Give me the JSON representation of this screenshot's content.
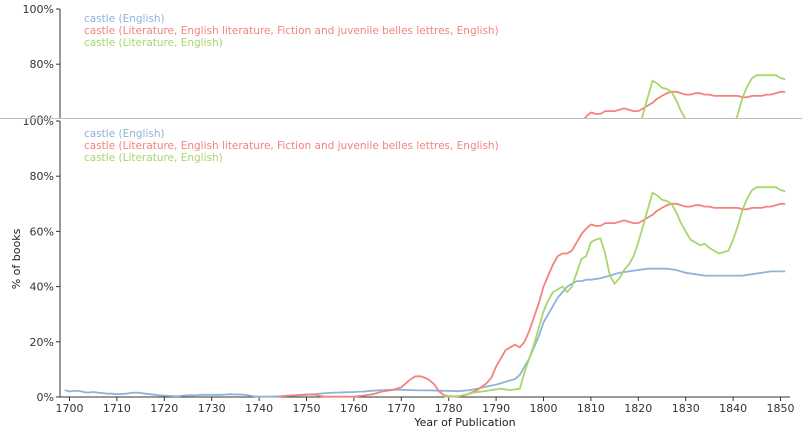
{
  "chart_data": {
    "type": "line",
    "xlabel": "Year of Publication",
    "ylabel": "% of books",
    "xlim": [
      1698,
      1852
    ],
    "ylim": [
      0,
      100
    ],
    "x_ticks": [
      "1700",
      "1710",
      "1720",
      "1730",
      "1740",
      "1750",
      "1760",
      "1770",
      "1780",
      "1790",
      "1800",
      "1810",
      "1820",
      "1830",
      "1840",
      "1850"
    ],
    "y_ticks": [
      "0%",
      "20%",
      "40%",
      "60%",
      "80%",
      "100%"
    ],
    "legend_position": "top-left",
    "grid": false,
    "series": [
      {
        "name": "castle (English)",
        "color": "#8fb3d9",
        "points": [
          [
            1699,
            2.5
          ],
          [
            1700,
            2
          ],
          [
            1701,
            2.2
          ],
          [
            1702,
            2.2
          ],
          [
            1703,
            1.8
          ],
          [
            1704,
            1.6
          ],
          [
            1705,
            1.8
          ],
          [
            1706,
            1.6
          ],
          [
            1707,
            1.4
          ],
          [
            1708,
            1.2
          ],
          [
            1709,
            1.2
          ],
          [
            1710,
            1
          ],
          [
            1711,
            1.1
          ],
          [
            1712,
            1.2
          ],
          [
            1713,
            1.5
          ],
          [
            1714,
            1.6
          ],
          [
            1715,
            1.5
          ],
          [
            1716,
            1.2
          ],
          [
            1717,
            1
          ],
          [
            1718,
            0.8
          ],
          [
            1719,
            0.6
          ],
          [
            1720,
            0.5
          ],
          [
            1721,
            0.4
          ],
          [
            1722,
            0.3
          ],
          [
            1723,
            0.3
          ],
          [
            1724,
            0.5
          ],
          [
            1725,
            0.6
          ],
          [
            1726,
            0.6
          ],
          [
            1727,
            0.7
          ],
          [
            1728,
            0.8
          ],
          [
            1729,
            0.8
          ],
          [
            1730,
            0.8
          ],
          [
            1731,
            0.8
          ],
          [
            1732,
            0.8
          ],
          [
            1733,
            0.9
          ],
          [
            1734,
            1
          ],
          [
            1735,
            0.9
          ],
          [
            1736,
            0.9
          ],
          [
            1737,
            0.8
          ],
          [
            1738,
            0.5
          ],
          [
            1739,
            0.2
          ],
          [
            1740,
            0.1
          ],
          [
            1742,
            0.1
          ],
          [
            1744,
            0.2
          ],
          [
            1746,
            0.4
          ],
          [
            1748,
            0.6
          ],
          [
            1750,
            0.8
          ],
          [
            1752,
            1.1
          ],
          [
            1754,
            1.4
          ],
          [
            1756,
            1.6
          ],
          [
            1758,
            1.7
          ],
          [
            1760,
            1.8
          ],
          [
            1762,
            2
          ],
          [
            1764,
            2.3
          ],
          [
            1766,
            2.5
          ],
          [
            1768,
            2.6
          ],
          [
            1770,
            2.6
          ],
          [
            1772,
            2.5
          ],
          [
            1774,
            2.4
          ],
          [
            1776,
            2.4
          ],
          [
            1778,
            2.3
          ],
          [
            1780,
            2.2
          ],
          [
            1782,
            2.1
          ],
          [
            1784,
            2.4
          ],
          [
            1786,
            3
          ],
          [
            1788,
            3.8
          ],
          [
            1790,
            4.5
          ],
          [
            1791,
            5
          ],
          [
            1792,
            5.5
          ],
          [
            1793,
            6
          ],
          [
            1794,
            6.5
          ],
          [
            1795,
            8
          ],
          [
            1796,
            11
          ],
          [
            1797,
            14
          ],
          [
            1798,
            18
          ],
          [
            1799,
            22
          ],
          [
            1800,
            27
          ],
          [
            1801,
            30
          ],
          [
            1802,
            33
          ],
          [
            1803,
            36
          ],
          [
            1804,
            38
          ],
          [
            1805,
            40
          ],
          [
            1806,
            41
          ],
          [
            1807,
            42
          ],
          [
            1808,
            42
          ],
          [
            1809,
            42.5
          ],
          [
            1810,
            42.5
          ],
          [
            1812,
            43
          ],
          [
            1814,
            44
          ],
          [
            1816,
            45
          ],
          [
            1818,
            45.5
          ],
          [
            1820,
            46
          ],
          [
            1822,
            46.5
          ],
          [
            1824,
            46.5
          ],
          [
            1826,
            46.5
          ],
          [
            1828,
            46
          ],
          [
            1830,
            45
          ],
          [
            1832,
            44.5
          ],
          [
            1834,
            44
          ],
          [
            1836,
            44
          ],
          [
            1838,
            44
          ],
          [
            1840,
            44
          ],
          [
            1842,
            44
          ],
          [
            1844,
            44.5
          ],
          [
            1846,
            45
          ],
          [
            1848,
            45.5
          ],
          [
            1850,
            45.5
          ],
          [
            1851,
            45.5
          ]
        ]
      },
      {
        "name": "castle (Literature, English literature, Fiction and juvenile belles lettres, English)",
        "color": "#f4837d",
        "points": [
          [
            1744,
            0.1
          ],
          [
            1746,
            0.5
          ],
          [
            1748,
            0.7
          ],
          [
            1750,
            0.9
          ],
          [
            1752,
            0.8
          ],
          [
            1753,
            0.3
          ],
          [
            1754,
            0.1
          ],
          [
            1760,
            0.1
          ],
          [
            1762,
            0.5
          ],
          [
            1764,
            1
          ],
          [
            1766,
            2
          ],
          [
            1768,
            2.5
          ],
          [
            1770,
            3.5
          ],
          [
            1771,
            5
          ],
          [
            1772,
            6.5
          ],
          [
            1773,
            7.5
          ],
          [
            1774,
            7.5
          ],
          [
            1775,
            7
          ],
          [
            1776,
            6
          ],
          [
            1777,
            4.5
          ],
          [
            1778,
            2
          ],
          [
            1779,
            0.6
          ],
          [
            1780,
            0.3
          ],
          [
            1782,
            0.2
          ],
          [
            1784,
            1
          ],
          [
            1786,
            2.5
          ],
          [
            1788,
            5
          ],
          [
            1789,
            7
          ],
          [
            1790,
            11
          ],
          [
            1791,
            14
          ],
          [
            1792,
            17
          ],
          [
            1793,
            18
          ],
          [
            1794,
            19
          ],
          [
            1795,
            18
          ],
          [
            1796,
            20
          ],
          [
            1797,
            24
          ],
          [
            1798,
            29
          ],
          [
            1799,
            34
          ],
          [
            1800,
            40
          ],
          [
            1801,
            44
          ],
          [
            1802,
            48
          ],
          [
            1803,
            51
          ],
          [
            1804,
            52
          ],
          [
            1805,
            52
          ],
          [
            1806,
            53
          ],
          [
            1807,
            56
          ],
          [
            1808,
            59
          ],
          [
            1809,
            61
          ],
          [
            1810,
            62.5
          ],
          [
            1811,
            62
          ],
          [
            1812,
            62
          ],
          [
            1813,
            63
          ],
          [
            1814,
            63
          ],
          [
            1815,
            63
          ],
          [
            1816,
            63.5
          ],
          [
            1817,
            64
          ],
          [
            1818,
            63.5
          ],
          [
            1819,
            63
          ],
          [
            1820,
            63
          ],
          [
            1821,
            64
          ],
          [
            1822,
            65
          ],
          [
            1823,
            66
          ],
          [
            1824,
            67.5
          ],
          [
            1825,
            68.5
          ],
          [
            1826,
            69.5
          ],
          [
            1827,
            70
          ],
          [
            1828,
            70
          ],
          [
            1829,
            69.5
          ],
          [
            1830,
            69
          ],
          [
            1831,
            69
          ],
          [
            1832,
            69.5
          ],
          [
            1833,
            69.5
          ],
          [
            1834,
            69
          ],
          [
            1835,
            69
          ],
          [
            1836,
            68.5
          ],
          [
            1837,
            68.5
          ],
          [
            1838,
            68.5
          ],
          [
            1839,
            68.5
          ],
          [
            1840,
            68.5
          ],
          [
            1841,
            68.5
          ],
          [
            1842,
            68
          ],
          [
            1843,
            68
          ],
          [
            1844,
            68.5
          ],
          [
            1845,
            68.5
          ],
          [
            1846,
            68.5
          ],
          [
            1847,
            69
          ],
          [
            1848,
            69
          ],
          [
            1849,
            69.5
          ],
          [
            1850,
            70
          ],
          [
            1851,
            70
          ]
        ]
      },
      {
        "name": "castle (Literature, English)",
        "color": "#a8d66c",
        "points": [
          [
            1779,
            0.1
          ],
          [
            1781,
            0.1
          ],
          [
            1783,
            0.5
          ],
          [
            1785,
            1.5
          ],
          [
            1787,
            2
          ],
          [
            1789,
            2.5
          ],
          [
            1791,
            3
          ],
          [
            1793,
            2.5
          ],
          [
            1795,
            3
          ],
          [
            1796,
            9
          ],
          [
            1797,
            14
          ],
          [
            1798,
            19
          ],
          [
            1799,
            25
          ],
          [
            1800,
            31
          ],
          [
            1801,
            35
          ],
          [
            1802,
            38
          ],
          [
            1803,
            39
          ],
          [
            1804,
            40
          ],
          [
            1805,
            38
          ],
          [
            1806,
            40
          ],
          [
            1807,
            45
          ],
          [
            1808,
            50
          ],
          [
            1809,
            51
          ],
          [
            1810,
            56
          ],
          [
            1811,
            57
          ],
          [
            1812,
            57.5
          ],
          [
            1813,
            52
          ],
          [
            1814,
            44
          ],
          [
            1815,
            41
          ],
          [
            1816,
            43
          ],
          [
            1817,
            46
          ],
          [
            1818,
            48
          ],
          [
            1819,
            51
          ],
          [
            1820,
            56
          ],
          [
            1821,
            62
          ],
          [
            1822,
            68
          ],
          [
            1823,
            74
          ],
          [
            1824,
            73
          ],
          [
            1825,
            71.5
          ],
          [
            1826,
            71
          ],
          [
            1827,
            70
          ],
          [
            1828,
            67
          ],
          [
            1829,
            63
          ],
          [
            1830,
            60
          ],
          [
            1831,
            57
          ],
          [
            1832,
            56
          ],
          [
            1833,
            55
          ],
          [
            1834,
            55.5
          ],
          [
            1835,
            54
          ],
          [
            1836,
            53
          ],
          [
            1837,
            52
          ],
          [
            1838,
            52.5
          ],
          [
            1839,
            53
          ],
          [
            1840,
            57
          ],
          [
            1841,
            62
          ],
          [
            1842,
            68
          ],
          [
            1843,
            72
          ],
          [
            1844,
            75
          ],
          [
            1845,
            76
          ],
          [
            1846,
            76
          ],
          [
            1847,
            76
          ],
          [
            1848,
            76
          ],
          [
            1849,
            76
          ],
          [
            1850,
            75
          ],
          [
            1851,
            74.5
          ]
        ]
      }
    ]
  }
}
